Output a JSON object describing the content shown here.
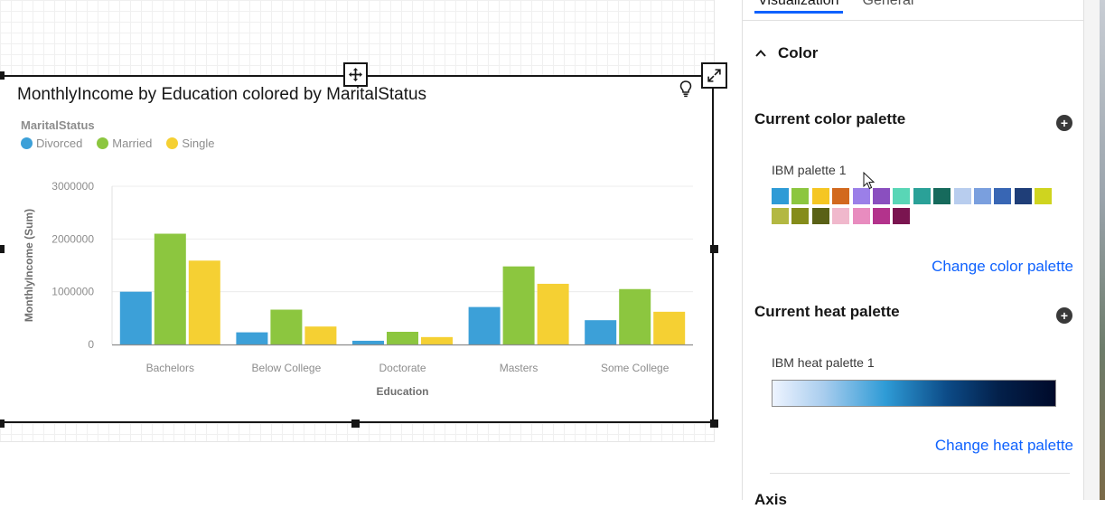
{
  "chart_data": {
    "type": "bar",
    "title": "MonthlyIncome by Education colored by MaritalStatus",
    "legend_title": "MaritalStatus",
    "xlabel": "Education",
    "ylabel": "MonthlyIncome (Sum)",
    "categories": [
      "Bachelors",
      "Below College",
      "Doctorate",
      "Masters",
      "Some College"
    ],
    "series": [
      {
        "name": "Divorced",
        "color": "#3ca0d8",
        "values": [
          1000000,
          230000,
          70000,
          710000,
          460000
        ]
      },
      {
        "name": "Married",
        "color": "#8cc63f",
        "values": [
          2100000,
          660000,
          240000,
          1480000,
          1050000
        ]
      },
      {
        "name": "Single",
        "color": "#f5d033",
        "values": [
          1590000,
          340000,
          140000,
          1150000,
          620000
        ]
      }
    ],
    "ylim": [
      0,
      3000000
    ],
    "yticks": [
      "0",
      "1000000",
      "2000000",
      "3000000"
    ],
    "grid": true,
    "legend_position": "top-left"
  },
  "panel": {
    "tabs": [
      "Visualization",
      "General"
    ],
    "active_tab": "Visualization",
    "section_title": "Color",
    "color_palette_heading": "Current color palette",
    "color_palette_name": "IBM palette 1",
    "color_swatches": [
      "#2e9bd6",
      "#8cc63f",
      "#f5c623",
      "#d2691e",
      "#9b7fe8",
      "#8a4fbf",
      "#59d6b6",
      "#2aa198",
      "#166a5c",
      "#b8cdee",
      "#7a9fde",
      "#3866b4",
      "#1f3e78",
      "#cfd41f",
      "#b3b842",
      "#858c1a",
      "#5a6116",
      "#f0b8cc",
      "#e88cbf",
      "#b3338c",
      "#7a1550"
    ],
    "change_color_link": "Change color palette",
    "heat_palette_heading": "Current heat palette",
    "heat_palette_name": "IBM heat palette 1",
    "change_heat_link": "Change heat palette",
    "axis_heading": "Axis"
  }
}
